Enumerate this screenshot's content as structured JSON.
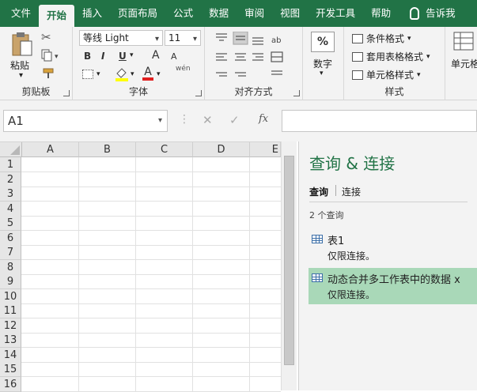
{
  "ribbon_tabs": [
    "文件",
    "开始",
    "插入",
    "页面布局",
    "公式",
    "数据",
    "审阅",
    "视图",
    "开发工具",
    "帮助"
  ],
  "tell_me": "告诉我",
  "clipboard": {
    "paste": "粘贴",
    "label": "剪贴板"
  },
  "font": {
    "name": "等线 Light",
    "size": "11",
    "bold": "B",
    "italic": "I",
    "underline": "U",
    "grow": "A",
    "shrink": "A",
    "label": "字体",
    "wen": "wén"
  },
  "alignment": {
    "label": "对齐方式"
  },
  "number": {
    "btn": "数字",
    "symbol": "%"
  },
  "styles": {
    "conditional": "条件格式",
    "table": "套用表格格式",
    "cell": "单元格样式",
    "label": "样式"
  },
  "cells": {
    "btn": "单元格"
  },
  "formula_bar": {
    "name_box": "A1",
    "fx": "fx",
    "cancel": "✕",
    "enter": "✓"
  },
  "sheet": {
    "columns": [
      "A",
      "B",
      "C",
      "D",
      "E"
    ],
    "rows": [
      "1",
      "2",
      "3",
      "4",
      "5",
      "6",
      "7",
      "8",
      "9",
      "10",
      "11",
      "12",
      "13",
      "14",
      "15",
      "16"
    ]
  },
  "pane": {
    "title": "查询 & 连接",
    "tab_queries": "查询",
    "tab_connections": "连接",
    "count": "2 个查询",
    "queries": [
      {
        "name": "表1",
        "status": "仅限连接。"
      },
      {
        "name": "动态合并多工作表中的数据 x",
        "status": "仅限连接。"
      }
    ]
  },
  "colors": {
    "accent": "#217346",
    "selected": "#a9d8b8"
  }
}
